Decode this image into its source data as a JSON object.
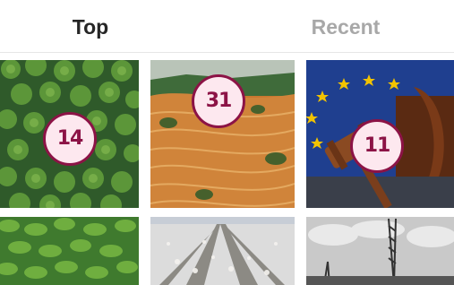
{
  "tabs": [
    {
      "label": "Top",
      "active": true
    },
    {
      "label": "Recent",
      "active": false
    }
  ],
  "posts": [
    {
      "subject": "palm-plantation-aerial",
      "count": "14"
    },
    {
      "subject": "deforested-hills-terraces",
      "count": "31"
    },
    {
      "subject": "gavel-eu-flag",
      "count": "11"
    },
    {
      "subject": "green-crop-field",
      "count": null
    },
    {
      "subject": "cotton-field-rows",
      "count": null
    },
    {
      "subject": "construction-crane-bw",
      "count": null
    }
  ],
  "colors": {
    "badge_fill": "#fde8ef",
    "badge_accent": "#8c1346",
    "tab_active": "#262626",
    "tab_inactive": "#a8a8a8"
  }
}
